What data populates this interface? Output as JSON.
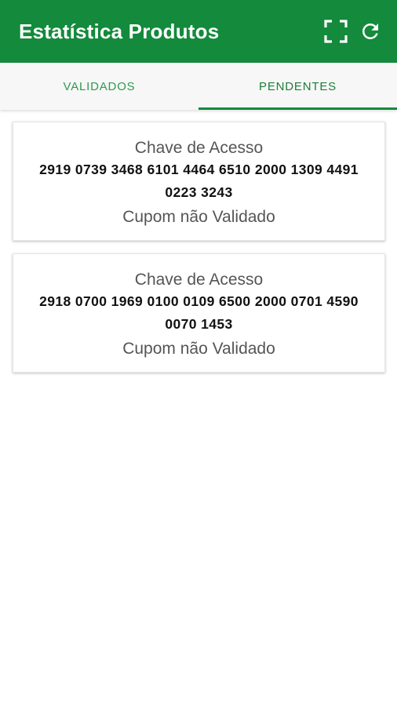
{
  "appbar": {
    "title": "Estatística Produtos",
    "background": "#138a3c",
    "actions": [
      {
        "icon": "fullscreen-icon"
      },
      {
        "icon": "refresh-icon"
      }
    ]
  },
  "tabs": [
    {
      "label": "VALIDADOS",
      "active": false
    },
    {
      "label": "PENDENTES",
      "active": true
    }
  ],
  "cards": [
    {
      "label": "Chave de Acesso",
      "key": "2919 0739 3468 6101 4464 6510 2000 1309 4491 0223 3243",
      "status": "Cupom não Validado"
    },
    {
      "label": "Chave de Acesso",
      "key": "2918 0700 1969 0100 0109 6500 2000 0701 4590 0070 1453",
      "status": "Cupom não Validado"
    }
  ]
}
